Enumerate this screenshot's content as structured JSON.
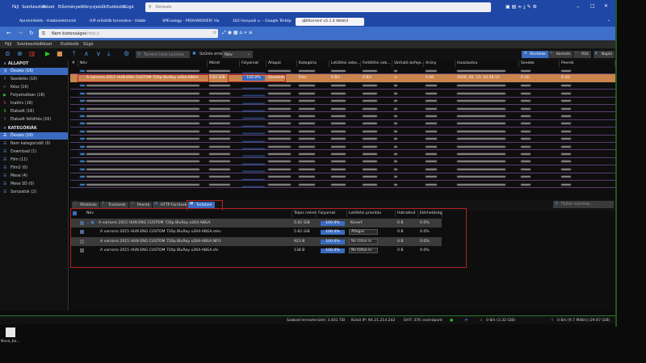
{
  "browser": {
    "menu": [
      "Fájl",
      "Szerkesztés",
      "Nézet",
      "Előzmények",
      "Könyvjelzők",
      "Eszközök",
      "Súgó"
    ],
    "search_placeholder": "Keresés",
    "tabs": [
      "Aprohirdetés - Hobbielektronik",
      "Hifi erősítők tervezése - Hobbi",
      "XPEnology - PROHARDVER! Ho",
      "162 Hunyadi u. – Google Térkép",
      "qBittorrent v5.1.4 WebUI"
    ],
    "security": "Nem biztonságos",
    "url": "http://"
  },
  "app": {
    "menu": [
      "Fájl",
      "Szerkesztés",
      "Nézet",
      "Eszközök",
      "Súgó"
    ],
    "filter_placeholder": "Torrent lista szűrése",
    "sort_label": "Szűrés erre:",
    "sort_value": "Név",
    "right_buttons": [
      "Átvitelek",
      "Keresés",
      "RSS",
      "Napló"
    ],
    "accent": "#3a6bc0",
    "selected_row_color": "#c9844d"
  },
  "sidebar": {
    "status_header": "ÁLLAPOT",
    "status": [
      {
        "label": "Összes (16)",
        "icon": "shuffle-icon"
      },
      {
        "label": "Seedelés (16)",
        "icon": "upload-icon"
      },
      {
        "label": "Kész (16)",
        "icon": "check-icon"
      },
      {
        "label": "Folyamatban (16)",
        "icon": "play-icon"
      },
      {
        "label": "Inaktív (16)",
        "icon": "inactive-icon"
      },
      {
        "label": "Elakadt (16)",
        "icon": "stalled-icon"
      },
      {
        "label": "Elakadt feltöltés (16)",
        "icon": "stalled-upload-icon"
      }
    ],
    "cat_header": "KATEGÓRIÁK",
    "categories": [
      "Összes (16)",
      "Nem kategorizált (0)",
      "Download (1)",
      "Film (11)",
      "Film2 (0)",
      "Mese (4)",
      "Mese SD (0)",
      "Sorozatok (2)"
    ]
  },
  "torrents": {
    "columns": [
      "#",
      "Név",
      "Méret",
      "Folyamat",
      "Állapot",
      "Kategória",
      "Letöltési sebe...",
      "Feltöltési seb...",
      "Várható befeje...",
      "Arány",
      "Hozzáadva",
      "Seedek",
      "Peerek"
    ],
    "selected": {
      "name": "A varrorro 2015 HUN ENG CUSTOM 720p BluRay x264-ABGA",
      "size": "5.62 GiB",
      "progress": "100.0%",
      "state": "Seedelés",
      "category": "Film",
      "dl": "0 B/s",
      "ul": "0 B/s",
      "eta": "∞",
      "ratio": "0.00",
      "added": "2026. 02. 13. 10:38:12",
      "seeds": "0 (4)",
      "peers": "0 (0)"
    }
  },
  "bottom": {
    "tabs": [
      "Általános",
      "Trackerek",
      "Peerek",
      "HTTP Források",
      "Tartalom"
    ],
    "file_filter_placeholder": "Fájlok szűrése...",
    "columns": [
      "Név",
      "Teljes méret",
      "Folyamat",
      "Letöltési prioritás",
      "Hátralévő",
      "Elérhetőség"
    ],
    "files": [
      {
        "name": "A varrorro 2015 HUN ENG CUSTOM 720p BluRay x264-ABGA",
        "size": "5.62 GiB",
        "progress": "100.0%",
        "priority": "Kevert",
        "remaining": "0 B",
        "availability": "0.0%"
      },
      {
        "name": "A varrorro 2015 HUN ENG CUSTOM 720p BluRay x264-ABGA.mkv",
        "size": "5.62 GiB",
        "progress": "100.0%",
        "priority": "Átlagos",
        "remaining": "0 B",
        "availability": "0.0%"
      },
      {
        "name": "A varrorro 2015 HUN ENG CUSTOM 720p BluRay x264-ABGA.NFO",
        "size": "923 B",
        "progress": "100.0%",
        "priority": "Ne töltse le",
        "remaining": "0 B",
        "availability": "0.0%"
      },
      {
        "name": "A varrorro 2015 HUN ENG CUSTOM 720p BluRay x264-ABGA.sfv",
        "size": "138 B",
        "progress": "100.0%",
        "priority": "Ne töltse le",
        "remaining": "0 B",
        "availability": "0.0%"
      }
    ]
  },
  "status": {
    "free": "Szabad lemezterület: 3.401 TiB",
    "ip": "Külső IP: 94.21.214.242",
    "dht": "DHT: 376 csomópont",
    "down": "0 B/s (3.32 GiB)",
    "up": "0 B/s [9.7 MiB/s] (29.87 GiB)"
  },
  "desktop": {
    "icon_label": "Novo_bo..."
  }
}
